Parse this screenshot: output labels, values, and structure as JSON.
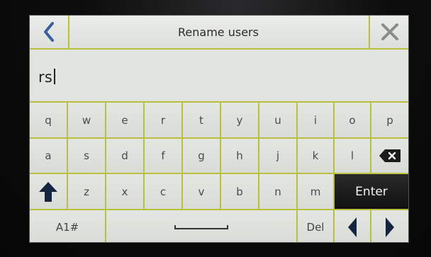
{
  "header": {
    "title": "Rename users",
    "back_icon": "chevron-left-icon",
    "close_icon": "close-icon"
  },
  "input": {
    "value": "rs"
  },
  "keyboard": {
    "row1": [
      "q",
      "w",
      "e",
      "r",
      "t",
      "y",
      "u",
      "i",
      "o",
      "p"
    ],
    "row2": [
      "a",
      "s",
      "d",
      "f",
      "g",
      "h",
      "j",
      "k",
      "l"
    ],
    "row2_icon": "backspace-icon",
    "row3_icon": "shift-arrow-up-icon",
    "row3": [
      "z",
      "x",
      "c",
      "v",
      "b",
      "n",
      "m"
    ],
    "enter_label": "Enter",
    "mode_label": "A1#",
    "space_icon": "space-icon",
    "del_label": "Del",
    "left_icon": "arrow-left-icon",
    "right_icon": "arrow-right-icon"
  },
  "colors": {
    "accent": "#b7c03f",
    "dark_key": "#1a1a1a"
  }
}
